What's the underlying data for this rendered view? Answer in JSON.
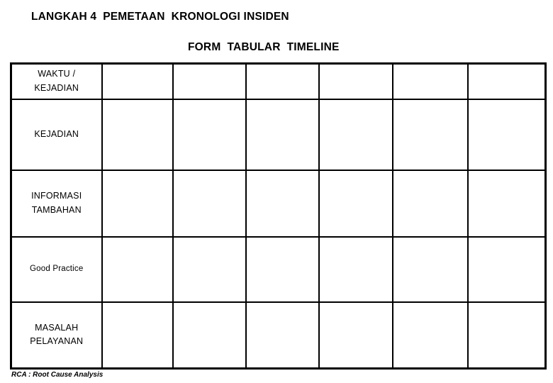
{
  "titles": {
    "main": "LANGKAH 4  PEMETAAN  KRONOLOGI INSIDEN",
    "sub": "FORM  TABULAR  TIMELINE"
  },
  "table": {
    "column_count": 7,
    "data_column_count": 6,
    "rows": [
      {
        "label_lines": [
          "WAKTU /",
          "KEJADIAN"
        ],
        "style": "normal",
        "cells": [
          "",
          "",
          "",
          "",
          "",
          ""
        ]
      },
      {
        "label_lines": [
          "KEJADIAN"
        ],
        "style": "normal",
        "cells": [
          "",
          "",
          "",
          "",
          "",
          ""
        ]
      },
      {
        "label_lines": [
          "INFORMASI",
          "TAMBAHAN"
        ],
        "style": "normal",
        "cells": [
          "",
          "",
          "",
          "",
          "",
          ""
        ]
      },
      {
        "label_lines": [
          "Good Practice"
        ],
        "style": "small",
        "cells": [
          "",
          "",
          "",
          "",
          "",
          ""
        ]
      },
      {
        "label_lines": [
          "MASALAH",
          "PELAYANAN"
        ],
        "style": "normal",
        "cells": [
          "",
          "",
          "",
          "",
          "",
          ""
        ]
      }
    ]
  },
  "footnote": "RCA : Root Cause Analysis",
  "colors": {
    "background": "#ffffff",
    "text": "#000000",
    "border": "#000000"
  }
}
